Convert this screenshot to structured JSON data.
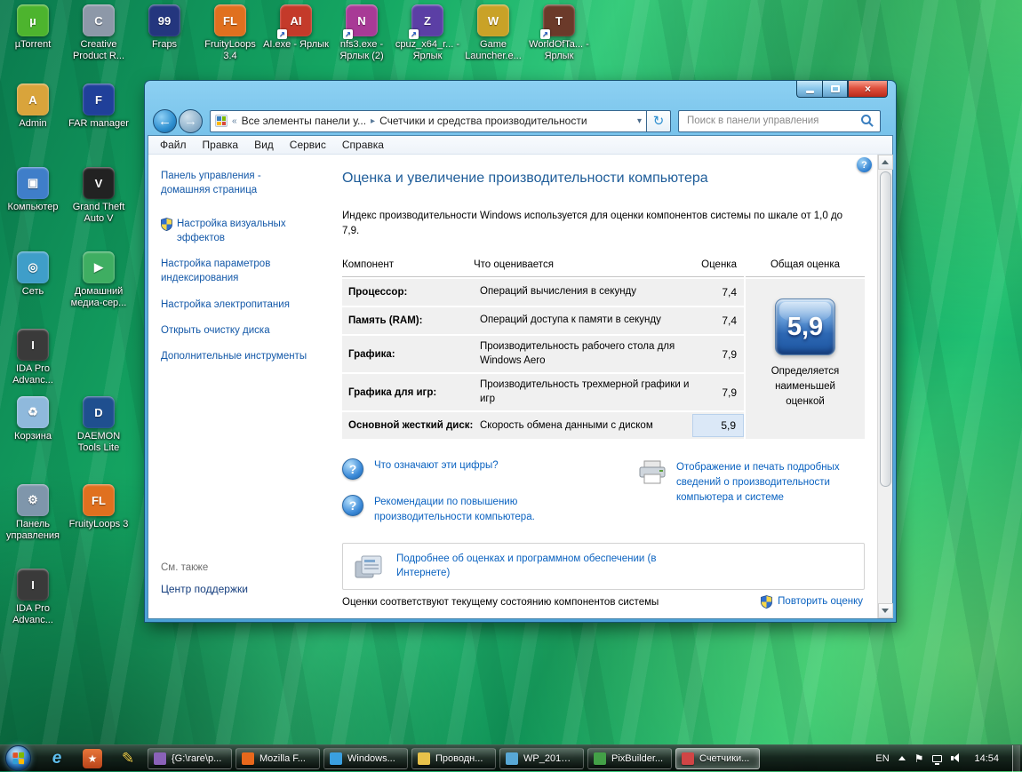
{
  "desktop": {
    "shortcut_glyph": "↗",
    "top_icons": [
      {
        "label": "µTorrent",
        "glyph": "µ",
        "bg": "#4db42e"
      },
      {
        "label": "Creative Product R...",
        "glyph": "C",
        "bg": "#8d98a8"
      },
      {
        "label": "Fraps",
        "glyph": "99",
        "bg": "#24367e"
      },
      {
        "label": "FruityLoops 3.4",
        "glyph": "FL",
        "bg": "#e0701f"
      },
      {
        "label": "AI.exe - Ярлык",
        "glyph": "AI",
        "bg": "#c43a2a"
      },
      {
        "label": "nfs3.exe - Ярлык (2)",
        "glyph": "N",
        "bg": "#a83a96"
      },
      {
        "label": "cpuz_x64_r... - Ярлык",
        "glyph": "Z",
        "bg": "#5b3fa5"
      },
      {
        "label": "Game Launcher.e...",
        "glyph": "W",
        "bg": "#c9a227"
      },
      {
        "label": "WorldOfTa... - Ярлык",
        "glyph": "T",
        "bg": "#6b3a2a"
      }
    ],
    "left_icons": [
      {
        "label": "Admin",
        "glyph": "A",
        "bg": "#d9a43b"
      },
      {
        "label": "FAR manager",
        "glyph": "F",
        "bg": "#20409a"
      },
      {
        "label": "Компьютер",
        "glyph": "▣",
        "bg": "#3f7ec9"
      },
      {
        "label": "Grand Theft Auto V",
        "glyph": "V",
        "bg": "#222222"
      },
      {
        "label": "Сеть",
        "glyph": "◎",
        "bg": "#3f9ec9"
      },
      {
        "label": "Домашний медиа-сер...",
        "glyph": "▶",
        "bg": "#3fae62"
      },
      {
        "label": "IDA Pro Advanc...",
        "glyph": "I",
        "bg": "#3a3a3a"
      },
      {
        "label": "Корзина",
        "glyph": "♻",
        "bg": "#8fb9dc"
      },
      {
        "label": "DAEMON Tools Lite",
        "glyph": "D",
        "bg": "#1f4f8f"
      },
      {
        "label": "Панель управления",
        "glyph": "⚙",
        "bg": "#7f96ab"
      },
      {
        "label": "FruityLoops 3",
        "glyph": "FL",
        "bg": "#e0701f"
      },
      {
        "label": "IDA Pro Advanc...",
        "glyph": "I",
        "bg": "#3a3a3a"
      }
    ]
  },
  "window": {
    "caption": {
      "close_glyph": "×"
    },
    "nav": {
      "back_glyph": "←",
      "forward_glyph": "→",
      "chevrons": "«",
      "crumb1": "Все элементы панели у...",
      "sep": "▸",
      "crumb2": "Счетчики и средства производительности",
      "caret": "▾",
      "refresh_glyph": "↻"
    },
    "search": {
      "placeholder": "Поиск в панели управления"
    },
    "menu": [
      "Файл",
      "Правка",
      "Вид",
      "Сервис",
      "Справка"
    ],
    "sidebar": {
      "home": "Панель управления - домашняя страница",
      "tasks": [
        "Настройка визуальных эффектов",
        "Настройка параметров индексирования",
        "Настройка электропитания",
        "Открыть очистку диска",
        "Дополнительные инструменты"
      ],
      "see_also": "См. также",
      "support_link": "Центр поддержки"
    },
    "content": {
      "help_glyph": "?",
      "q_glyph": "?",
      "title": "Оценка и увеличение производительности компьютера",
      "intro": "Индекс производительности Windows используется для оценки компонентов системы по шкале от 1,0 до 7,9.",
      "table": {
        "headers": [
          "Компонент",
          "Что оценивается",
          "Оценка",
          "Общая оценка"
        ],
        "rows": [
          {
            "component": "Процессор:",
            "measure": "Операций вычисления в секунду",
            "score": "7,4"
          },
          {
            "component": "Память (RAM):",
            "measure": "Операций доступа к памяти в секунду",
            "score": "7,4"
          },
          {
            "component": "Графика:",
            "measure": "Производительность рабочего стола для Windows Aero",
            "score": "7,9"
          },
          {
            "component": "Графика для игр:",
            "measure": "Производительность трехмерной графики и игр",
            "score": "7,9"
          },
          {
            "component": "Основной жесткий диск:",
            "measure": "Скорость обмена данными с диском",
            "score": "5,9"
          }
        ],
        "base_score": "5,9",
        "base_caption": "Определяется наименьшей оценкой"
      },
      "links": {
        "what": "Что означают эти цифры?",
        "tips": "Рекомендации по повышению производительности компьютера.",
        "print": "Отображение и печать подробных сведений о производительности компьютера и системе",
        "online": "Подробнее об оценках и программном обеспечении (в Интернете)"
      },
      "footer_status": "Оценки соответствуют текущему состоянию компонентов системы",
      "footer_rerun": "Повторить оценку"
    }
  },
  "taskbar": {
    "buttons": [
      {
        "label": "{G:\\rare\\p...",
        "icon_bg": "#8a62b8"
      },
      {
        "label": "Mozilla F...",
        "icon_bg": "#e8681c"
      },
      {
        "label": "Windows...",
        "icon_bg": "#3aa0e0"
      },
      {
        "label": "Проводн...",
        "icon_bg": "#e8c24a"
      },
      {
        "label": "WP_20151...",
        "icon_bg": "#58a8d6"
      },
      {
        "label": "PixBuilder...",
        "icon_bg": "#43a047"
      },
      {
        "label": "Счетчики...",
        "icon_bg": "#d04545"
      }
    ],
    "tray": {
      "lang": "EN",
      "flag_glyph": "⚑",
      "time": "14:54"
    }
  }
}
